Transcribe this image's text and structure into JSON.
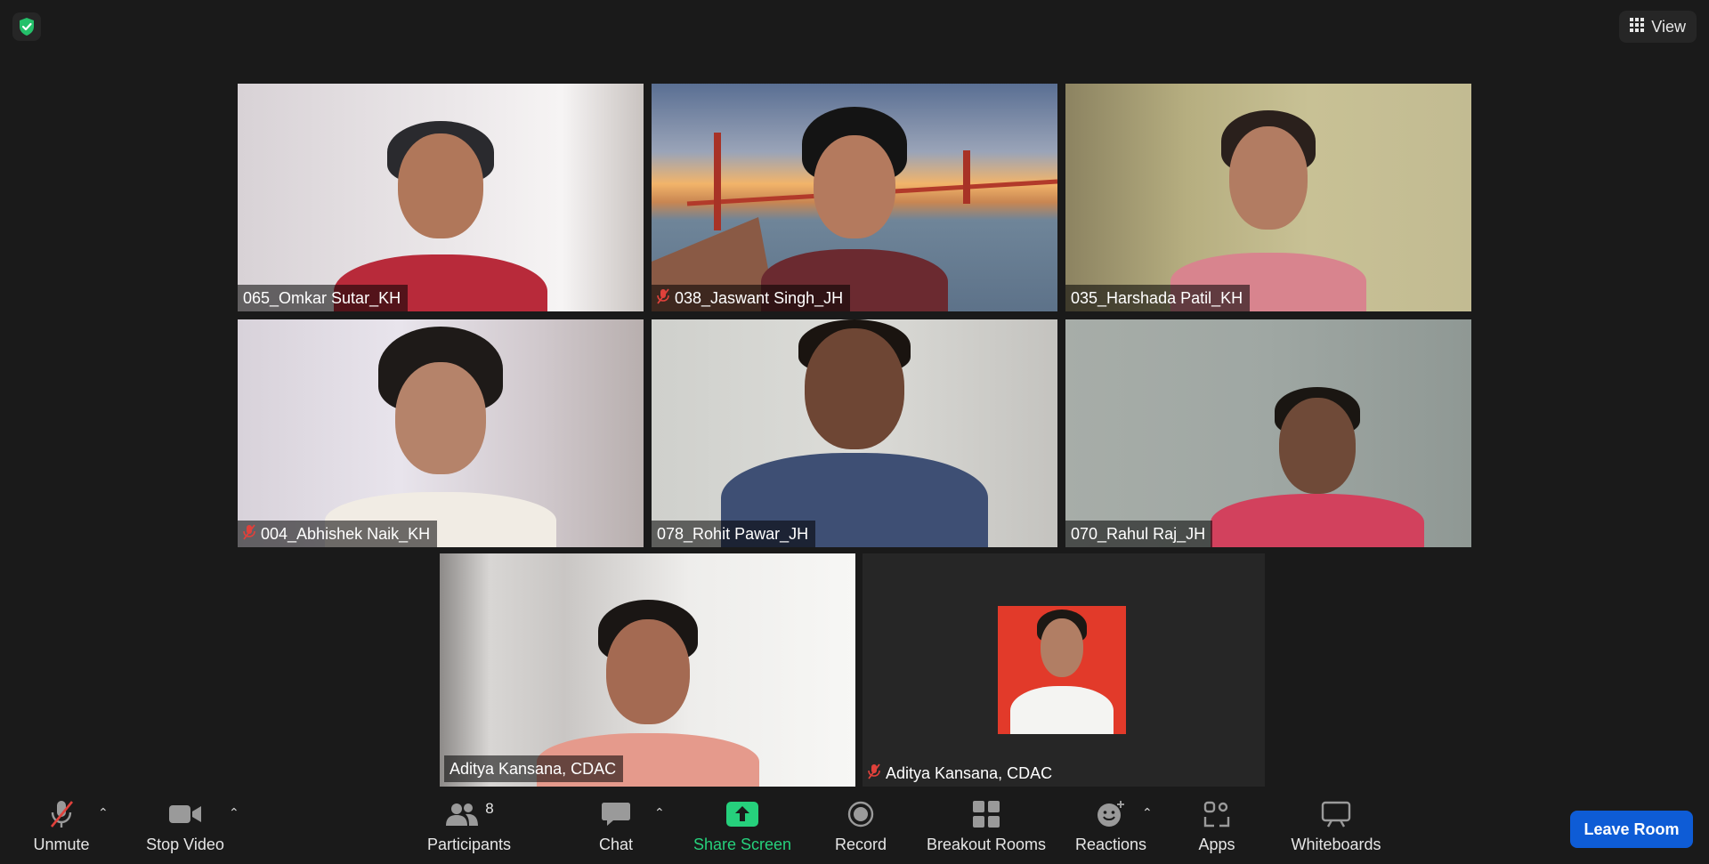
{
  "top": {
    "view_label": "View"
  },
  "tiles": [
    {
      "name": "065_Omkar Sutar_KH",
      "muted": false
    },
    {
      "name": "038_Jaswant Singh_JH",
      "muted": true
    },
    {
      "name": "035_Harshada Patil_KH",
      "muted": false
    },
    {
      "name": "004_Abhishek Naik_KH",
      "muted": true
    },
    {
      "name": "078_Rohit Pawar_JH",
      "muted": false
    },
    {
      "name": "070_Rahul Raj_JH",
      "muted": false
    },
    {
      "name": "Aditya Kansana, CDAC",
      "muted": false,
      "active": true
    },
    {
      "name": "Aditya Kansana, CDAC",
      "muted": true
    }
  ],
  "toolbar": {
    "unmute_label": "Unmute",
    "stop_video_label": "Stop Video",
    "participants_label": "Participants",
    "participants_count": "8",
    "chat_label": "Chat",
    "share_screen_label": "Share Screen",
    "record_label": "Record",
    "breakout_label": "Breakout Rooms",
    "reactions_label": "Reactions",
    "apps_label": "Apps",
    "whiteboards_label": "Whiteboards",
    "leave_label": "Leave Room"
  },
  "colors": {
    "accent_green": "#26d07c",
    "leave_blue": "#0e5cd6",
    "active_speaker_border": "#e8f27a",
    "mute_red": "#e0413b"
  },
  "icons": {
    "shield": "shield-check-icon",
    "view": "grid-icon",
    "muted": "mic-off-icon"
  }
}
